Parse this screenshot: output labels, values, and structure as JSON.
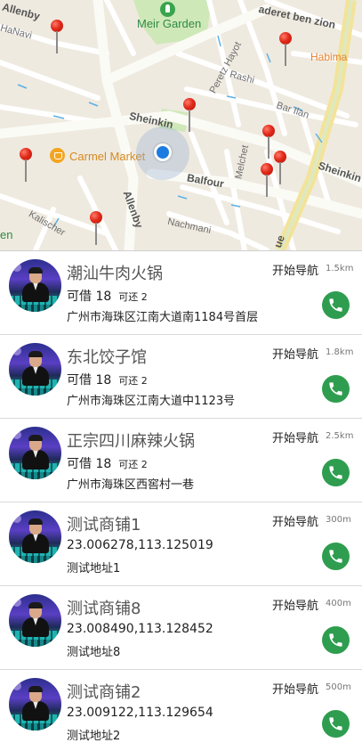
{
  "map": {
    "labels": {
      "allenby_top": "Allenby",
      "hanavi": "HaNavi",
      "meir_garden": "Meir Garden",
      "aderet_ben_zion": "aderet ben zion",
      "habima": "Habima",
      "peretz_hayot": "Peretz Hayot",
      "rashi": "Rashi",
      "bar_ilan": "Bar Ilan",
      "sheinkin": "Sheinkin",
      "sheinkin_right": "Sheinkin",
      "carmel_market": "Carmel Market",
      "balfour": "Balfour",
      "melchet": "Melchet",
      "allenby_bottom": "Allenby",
      "kalischer": "Kalischer",
      "nachmani": "Nachmani",
      "rothschild_fragment": "ue",
      "edge_fragment": "en"
    },
    "colors": {
      "background": "#efeae0",
      "road": "#ffffff",
      "main_road": "#f6e9a6",
      "park": "#cfe8b8",
      "pin": "#e12a1a",
      "user_location": "#1e7be0"
    }
  },
  "shops": [
    {
      "name": "潮汕牛肉火锅",
      "borrow_label": "可借",
      "borrow_count": "18",
      "return_label": "可还",
      "return_count": "2",
      "address": "广州市海珠区江南大道南1184号首层",
      "nav_label": "开始导航",
      "distance": "1.5km"
    },
    {
      "name": "东北饺子馆",
      "borrow_label": "可借",
      "borrow_count": "18",
      "return_label": "可还",
      "return_count": "2",
      "address": "广州市海珠区江南大道中1123号",
      "nav_label": "开始导航",
      "distance": "1.8km"
    },
    {
      "name": "正宗四川麻辣火锅",
      "borrow_label": "可借",
      "borrow_count": "18",
      "return_label": "可还",
      "return_count": "2",
      "address": "广州市海珠区西窖村一巷",
      "nav_label": "开始导航",
      "distance": "2.5km"
    },
    {
      "name": "测试商铺1",
      "coords": "23.006278,113.125019",
      "address": "测试地址1",
      "nav_label": "开始导航",
      "distance": "300m"
    },
    {
      "name": "测试商铺8",
      "coords": "23.008490,113.128452",
      "address": "测试地址8",
      "nav_label": "开始导航",
      "distance": "400m"
    },
    {
      "name": "测试商铺2",
      "coords": "23.009122,113.129654",
      "address": "测试地址2",
      "nav_label": "开始导航",
      "distance": "500m"
    }
  ],
  "icons": {
    "call": "phone-icon",
    "avatar": "shop-avatar"
  },
  "colors": {
    "call_button": "#2f9d4f",
    "name_text": "#555555",
    "divider": "#dadada"
  }
}
